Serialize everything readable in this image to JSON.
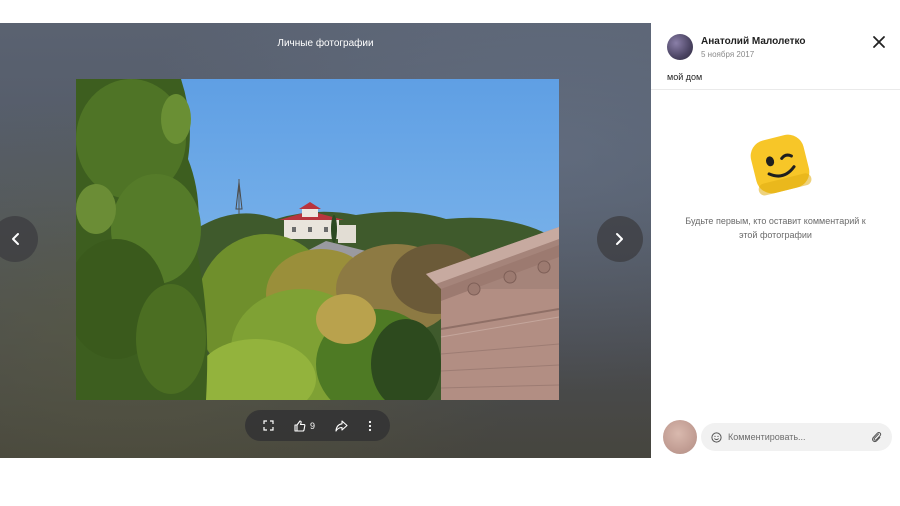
{
  "viewer": {
    "album_title": "Личные фотографии",
    "likes_count": "9",
    "icons": {
      "prev": "chevron-left-icon",
      "next": "chevron-right-icon",
      "fullscreen": "fullscreen-icon",
      "like": "thumbs-up-icon",
      "share": "share-arrow-icon",
      "more": "more-vertical-icon"
    }
  },
  "panel": {
    "author_name": "Анатолий Малолетко",
    "post_date": "5 ноября 2017",
    "caption": "мой дом",
    "empty_comments_text": "Будьте первым, кто оставит комментарий к этой фотографии",
    "comment_placeholder": "Комментировать...",
    "icons": {
      "close": "close-icon",
      "emoji": "emoji-icon",
      "attach": "paperclip-icon",
      "mascot": "winking-face-mascot-icon"
    }
  },
  "colors": {
    "mascot_yellow": "#f7c628",
    "viewer_background": "#535a66",
    "sky": "#69a9e8"
  }
}
